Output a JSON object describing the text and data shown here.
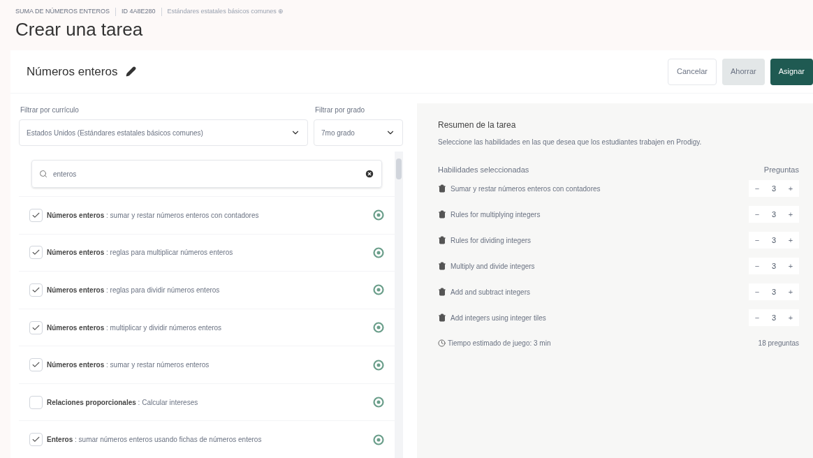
{
  "breadcrumb": {
    "topic": "SUMA DE NÚMEROS ENTEROS",
    "id": "ID 4A8E280",
    "curriculum": "Estándares estatales básicos comunes ⊕"
  },
  "title": "Crear una tarea",
  "card": {
    "name": "Números enteros",
    "buttons": [
      {
        "label": "Cancelar",
        "kind": "outline"
      },
      {
        "label": "Ahorrar",
        "kind": "muted"
      },
      {
        "label": "Asignar",
        "kind": "primary"
      }
    ]
  },
  "filters": [
    {
      "label": "Filtrar por currículo",
      "value": "Estados Unidos (Estándares estatales básicos comunes)"
    },
    {
      "label": "Filtrar por grado",
      "value": "7mo grado"
    }
  ],
  "search": {
    "value": "enteros"
  },
  "skills": [
    {
      "text": "**Números enteros** : sumar y restar números enteros con contadores",
      "checked": true
    },
    {
      "text": "**Números enteros** : reglas para multiplicar números enteros",
      "checked": true
    },
    {
      "text": "**Números enteros** : reglas para dividir números enteros",
      "checked": true
    },
    {
      "text": "**Números enteros** : multiplicar y dividir números enteros",
      "checked": true
    },
    {
      "text": "**Números enteros** : sumar y restar números enteros",
      "checked": true
    },
    {
      "text": "**Relaciones proporcionales** : Calcular intereses",
      "checked": false
    },
    {
      "text": "**Enteros** : sumar números enteros usando fichas de números enteros",
      "checked": true
    }
  ],
  "summary": {
    "title": "Resumen de la tarea",
    "description": "Seleccione las habilidades en las que desea que los estudiantes trabajen en Prodigy.",
    "skills_heading": "Habilidades seleccionadas",
    "questions_heading": "Preguntas",
    "selected": [
      {
        "name": "Sumar y restar números enteros con contadores",
        "count": "3"
      },
      {
        "name": "Rules for multiplying integers",
        "count": "3"
      },
      {
        "name": "Rules for dividing integers",
        "count": "3"
      },
      {
        "name": "Multiply and divide integers",
        "count": "3"
      },
      {
        "name": "Add and subtract integers",
        "count": "3"
      },
      {
        "name": "Add integers using integer tiles",
        "count": "3"
      }
    ],
    "minus": "−",
    "plus": "+",
    "time": "Tiempo estimado de juego: 3 min",
    "total": "18 preguntas"
  }
}
